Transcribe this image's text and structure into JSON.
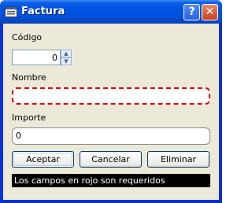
{
  "window": {
    "title": "Factura",
    "help_glyph": "?",
    "close_glyph": "✕"
  },
  "form": {
    "codigo": {
      "label": "Código",
      "value": "0"
    },
    "nombre": {
      "label": "Nombre",
      "value": ""
    },
    "importe": {
      "label": "Importe",
      "value": "0"
    }
  },
  "buttons": {
    "accept": "Aceptar",
    "cancel": "Cancelar",
    "delete": "Eliminar"
  },
  "status": {
    "message": "Los campos en rojo son requeridos"
  },
  "icons": {
    "title": "form-window-icon",
    "spin_up": "arrow-up-icon",
    "spin_down": "arrow-down-icon"
  },
  "colors": {
    "title_bar": "#0053e1",
    "required_border": "#e00000",
    "client_bg": "#ece9d8",
    "status_bg": "#000000",
    "status_text": "#ffffff"
  }
}
